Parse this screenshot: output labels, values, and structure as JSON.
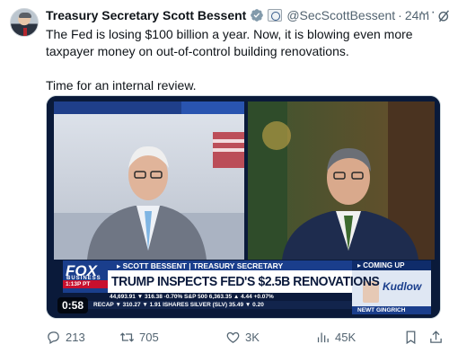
{
  "tweet": {
    "author_name": "Treasury Secretary Scott Bessent",
    "handle": "@SecScottBessent",
    "separator": "·",
    "time": "24m",
    "more_glyph": "···",
    "text_line1": "The Fed is losing $100 billion a year. Now, it is blowing even more taxpayer money on out-of-control building renovations.",
    "text_line2": "Time for an internal review."
  },
  "video": {
    "duration": "0:58",
    "lower_third": {
      "network": "FOX",
      "network_sub": "BUSINESS",
      "time_local": "1:13P PT",
      "speaker": "▸ SCOTT BESSENT | TREASURY SECRETARY",
      "headline": "TRUMP INSPECTS FED'S $2.5B RENOVATIONS",
      "ticker_line1": "44,693.91 ▼ 316.38 -0.70%  S&P 500  6,363.35 ▲ 4.44 +0.07%",
      "ticker_line2": "RECAP  ▼ 310.27  ▼ 1.91  ISHARES SILVER (SLV)  35.49  ▼ 0.20",
      "coming_up": "▸ COMING UP",
      "show_name": "Kudlow",
      "guest": "NEWT GINGRICH"
    }
  },
  "actions": {
    "replies": "213",
    "reposts": "705",
    "likes": "3K",
    "views": "45K"
  },
  "colors": {
    "accent_blue": "#1d9bf0",
    "text_secondary": "#536471",
    "fox_blue": "#1a3e8c",
    "fox_red": "#c8102e"
  },
  "icons": [
    "verified-badge-icon",
    "flag-badge-icon",
    "grok-icon",
    "more-icon",
    "reply-icon",
    "repost-icon",
    "like-icon",
    "views-icon",
    "bookmark-icon",
    "share-icon"
  ]
}
